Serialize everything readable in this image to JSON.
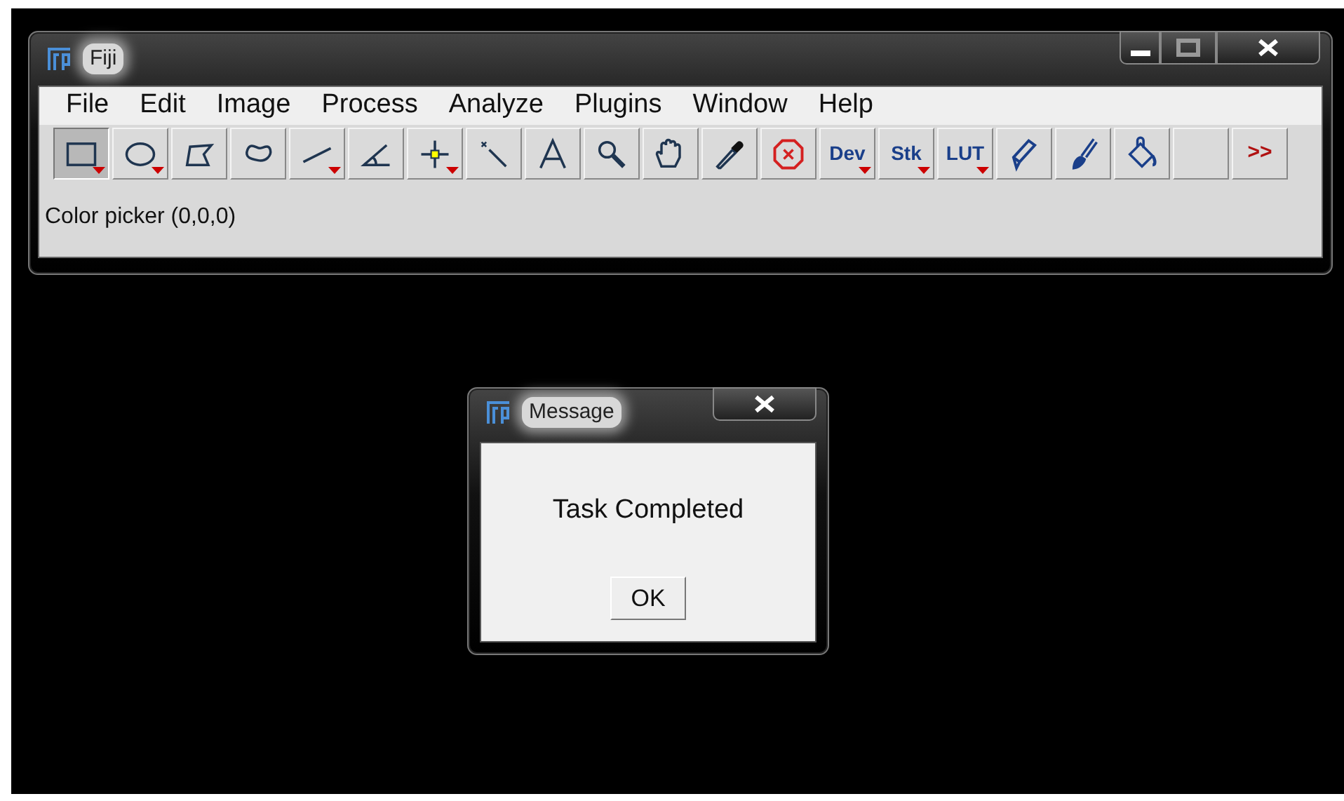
{
  "main_window": {
    "title": "Fiji",
    "menu": [
      "File",
      "Edit",
      "Image",
      "Process",
      "Analyze",
      "Plugins",
      "Window",
      "Help"
    ],
    "tools": [
      {
        "kind": "icon",
        "selected": true,
        "has_menu": true
      },
      {
        "kind": "icon",
        "selected": false,
        "has_menu": true
      },
      {
        "kind": "icon",
        "selected": false,
        "has_menu": false
      },
      {
        "kind": "icon",
        "selected": false,
        "has_menu": false
      },
      {
        "kind": "icon",
        "selected": false,
        "has_menu": true
      },
      {
        "kind": "icon",
        "selected": false,
        "has_menu": false
      },
      {
        "kind": "icon",
        "selected": false,
        "has_menu": true
      },
      {
        "kind": "icon",
        "selected": false,
        "has_menu": false
      },
      {
        "kind": "icon",
        "selected": false,
        "has_menu": false
      },
      {
        "kind": "icon",
        "selected": false,
        "has_menu": false
      },
      {
        "kind": "icon",
        "selected": false,
        "has_menu": false
      },
      {
        "kind": "icon",
        "selected": false,
        "has_menu": false
      },
      {
        "kind": "icon",
        "selected": false,
        "has_menu": false
      },
      {
        "kind": "text",
        "label": "Dev",
        "selected": false,
        "has_menu": true
      },
      {
        "kind": "text",
        "label": "Stk",
        "selected": false,
        "has_menu": true
      },
      {
        "kind": "text",
        "label": "LUT",
        "selected": false,
        "has_menu": true
      },
      {
        "kind": "icon",
        "selected": false,
        "has_menu": false
      },
      {
        "kind": "icon",
        "selected": false,
        "has_menu": false
      },
      {
        "kind": "icon",
        "selected": false,
        "has_menu": false
      },
      {
        "kind": "blank",
        "selected": false,
        "has_menu": false
      },
      {
        "kind": "more",
        "label": ">>",
        "selected": false,
        "has_menu": false
      }
    ],
    "status": "Color picker (0,0,0)"
  },
  "dialog": {
    "title": "Message",
    "message": "Task Completed",
    "button": "OK"
  }
}
